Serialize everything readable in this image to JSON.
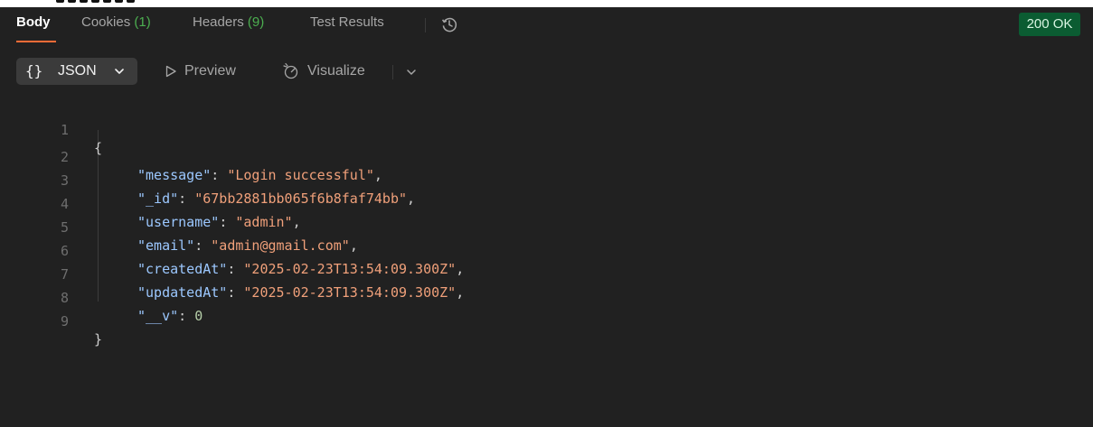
{
  "response_tabs": [
    {
      "label": "Body",
      "count": ""
    },
    {
      "label": "Cookies",
      "count": "(1)"
    },
    {
      "label": "Headers",
      "count": "(9)"
    },
    {
      "label": "Test Results",
      "count": ""
    }
  ],
  "status": "200 OK",
  "view": {
    "format_label": "JSON",
    "format_braces": "{}",
    "preview_label": "Preview",
    "visualize_label": "Visualize"
  },
  "code": {
    "line_numbers": [
      "1",
      "2",
      "3",
      "4",
      "5",
      "6",
      "7",
      "8",
      "9"
    ],
    "open_brace": "{",
    "close_brace": "}",
    "fields": [
      {
        "key": "\"message\"",
        "value": "\"Login successful\"",
        "comma": ","
      },
      {
        "key": "\"_id\"",
        "value": "\"67bb2881bb065f6b8faf74bb\"",
        "comma": ","
      },
      {
        "key": "\"username\"",
        "value": "\"admin\"",
        "comma": ","
      },
      {
        "key": "\"email\"",
        "value": "\"admin@gmail.com\"",
        "comma": ","
      },
      {
        "key": "\"createdAt\"",
        "value": "\"2025-02-23T13:54:09.300Z\"",
        "comma": ","
      },
      {
        "key": "\"updatedAt\"",
        "value": "\"2025-02-23T13:54:09.300Z\"",
        "comma": ","
      },
      {
        "key": "\"__v\"",
        "value": "0",
        "comma": ""
      }
    ]
  },
  "colors": {
    "accent": "#ff6c37",
    "count_green": "#4caf50",
    "status_bg": "#0b5c32",
    "json_key": "#9cc8ff",
    "json_string": "#f0a07a",
    "json_number": "#b5cea8"
  },
  "icons": [
    "history-icon",
    "chevron-down-icon",
    "play-icon",
    "visualize-icon"
  ]
}
